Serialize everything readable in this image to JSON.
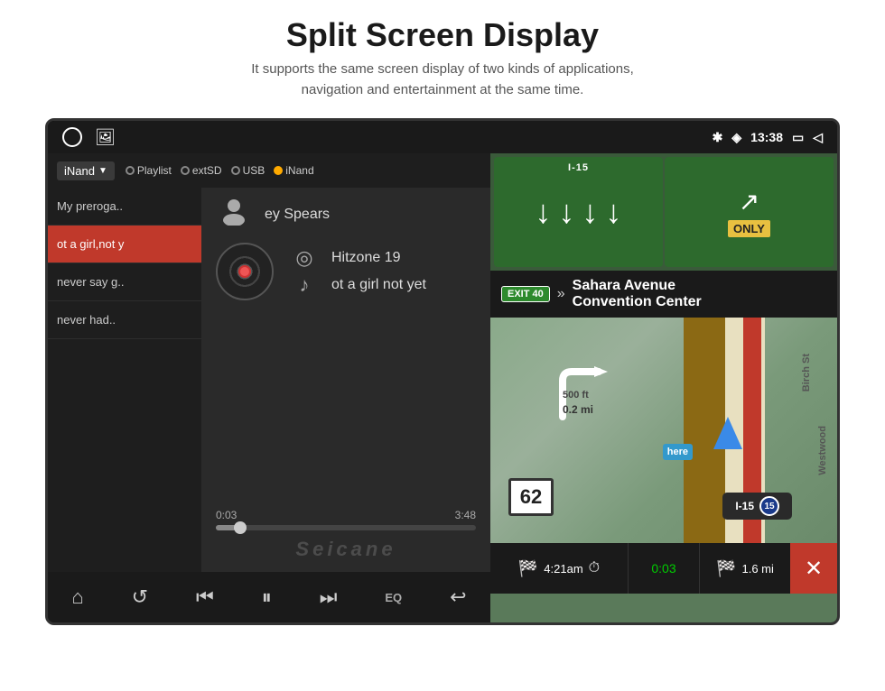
{
  "header": {
    "title": "Split Screen Display",
    "subtitle_line1": "It supports the same screen display of two kinds of applications,",
    "subtitle_line2": "navigation and entertainment at the same time."
  },
  "status_bar": {
    "time": "13:38",
    "bluetooth": "bluetooth",
    "location": "location",
    "battery": "battery",
    "back": "back"
  },
  "music_player": {
    "source_label": "iNand",
    "sources": [
      "Playlist",
      "extSD",
      "USB",
      "iNand"
    ],
    "playlist": [
      {
        "label": "My preroga..",
        "active": false
      },
      {
        "label": "ot a girl,not y",
        "active": true
      },
      {
        "label": "never say g..",
        "active": false
      },
      {
        "label": "never had..",
        "active": false
      }
    ],
    "artist": "ey Spears",
    "album": "Hitzone 19",
    "track": "ot a girl not yet",
    "time_current": "0:03",
    "time_total": "3:48",
    "watermark": "Seicane",
    "controls": [
      "home",
      "repeat",
      "prev",
      "pause",
      "next",
      "eq",
      "back"
    ]
  },
  "navigation": {
    "exit_number": "EXIT 40",
    "street_name": "Sahara Avenue",
    "place": "Convention Center",
    "road": "I-15",
    "shield_number": "15",
    "speed_limit": "62",
    "distance_500": "500 ft",
    "distance_mi": "0.2 mi",
    "eta": "4:21am",
    "elapsed": "0:03",
    "remaining": "1.6 mi",
    "only_label": "ONLY"
  }
}
